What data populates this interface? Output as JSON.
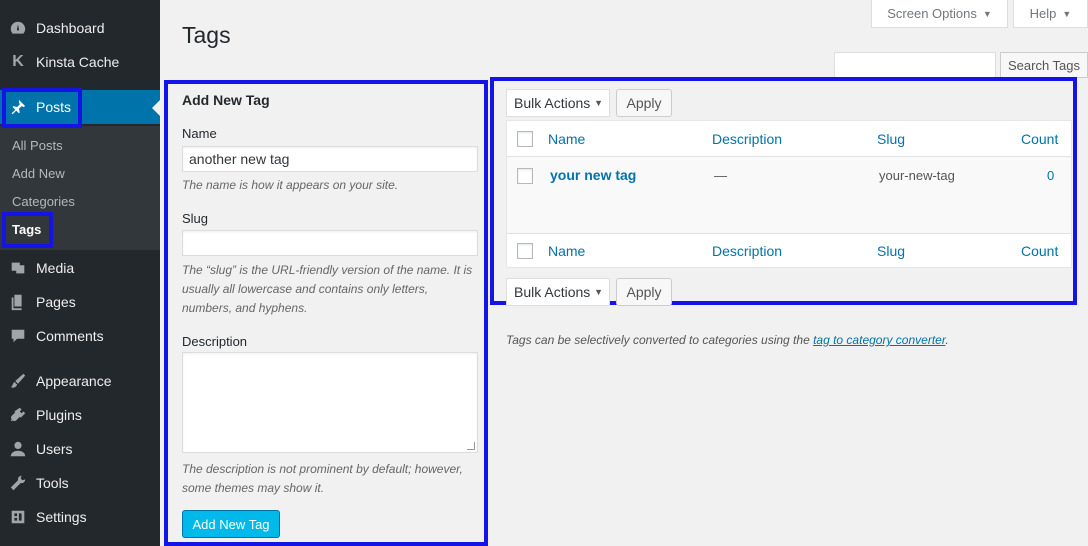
{
  "sidebar": {
    "items": [
      {
        "label": "Dashboard",
        "icon": "dashboard-icon"
      },
      {
        "label": "Kinsta Cache",
        "icon": "kinsta-k-icon"
      },
      {
        "label": "Posts",
        "icon": "pushpin-icon"
      },
      {
        "label": "Media",
        "icon": "media-icon"
      },
      {
        "label": "Pages",
        "icon": "pages-icon"
      },
      {
        "label": "Comments",
        "icon": "comments-icon"
      },
      {
        "label": "Appearance",
        "icon": "brush-icon"
      },
      {
        "label": "Plugins",
        "icon": "plugin-icon"
      },
      {
        "label": "Users",
        "icon": "users-icon"
      },
      {
        "label": "Tools",
        "icon": "wrench-icon"
      },
      {
        "label": "Settings",
        "icon": "settings-icon"
      }
    ],
    "posts_submenu": [
      "All Posts",
      "Add New",
      "Categories",
      "Tags"
    ],
    "active_color": "#0073aa"
  },
  "header": {
    "title": "Tags",
    "screen_options": "Screen Options",
    "help": "Help"
  },
  "search": {
    "value": "",
    "button": "Search Tags"
  },
  "form": {
    "heading": "Add New Tag",
    "name_label": "Name",
    "name_value": "another new tag",
    "name_help": "The name is how it appears on your site.",
    "slug_label": "Slug",
    "slug_value": "",
    "slug_help_1": "The “slug” is the URL-friendly version of the name. It is",
    "slug_help_2": "usually all lowercase and contains only letters,",
    "slug_help_3": "numbers, and hyphens.",
    "description_label": "Description",
    "description_value": "",
    "description_help_1": "The description is not prominent by default; however,",
    "description_help_2": "some themes may show it.",
    "submit": "Add New Tag"
  },
  "table": {
    "bulk_actions": "Bulk Actions",
    "apply": "Apply",
    "columns": {
      "name": "Name",
      "description": "Description",
      "slug": "Slug",
      "count": "Count"
    },
    "rows": [
      {
        "name": "your new tag",
        "description": "—",
        "slug": "your-new-tag",
        "count": "0"
      }
    ]
  },
  "note": {
    "text": "Tags can be selectively converted to categories using the ",
    "link": "tag to category converter",
    "end": "."
  },
  "colors": {
    "highlight": "#1414e6",
    "link": "#0073aa",
    "primary_button": "#00b9eb"
  }
}
